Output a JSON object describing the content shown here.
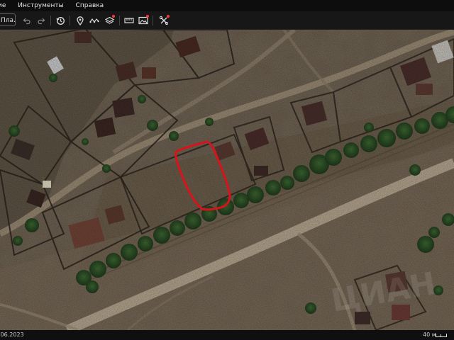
{
  "menu": {
    "items": [
      "ие",
      "Инструменты",
      "Справка"
    ]
  },
  "toolbar": {
    "place_field_value": "Пла..."
  },
  "status": {
    "date": ".06.2023",
    "scale_label": "40 м"
  },
  "colors": {
    "outline": "#d8131b",
    "alert_dot": "#ff3b30",
    "toolbar_icon": "#d9d9d9"
  },
  "icons": [
    "undo-icon",
    "redo-icon",
    "history-clock-icon",
    "placemark-icon",
    "path-icon",
    "polygon-layers-icon",
    "ruler-icon",
    "image-overlay-icon",
    "tour-icon"
  ],
  "watermark": "ЦИАН"
}
